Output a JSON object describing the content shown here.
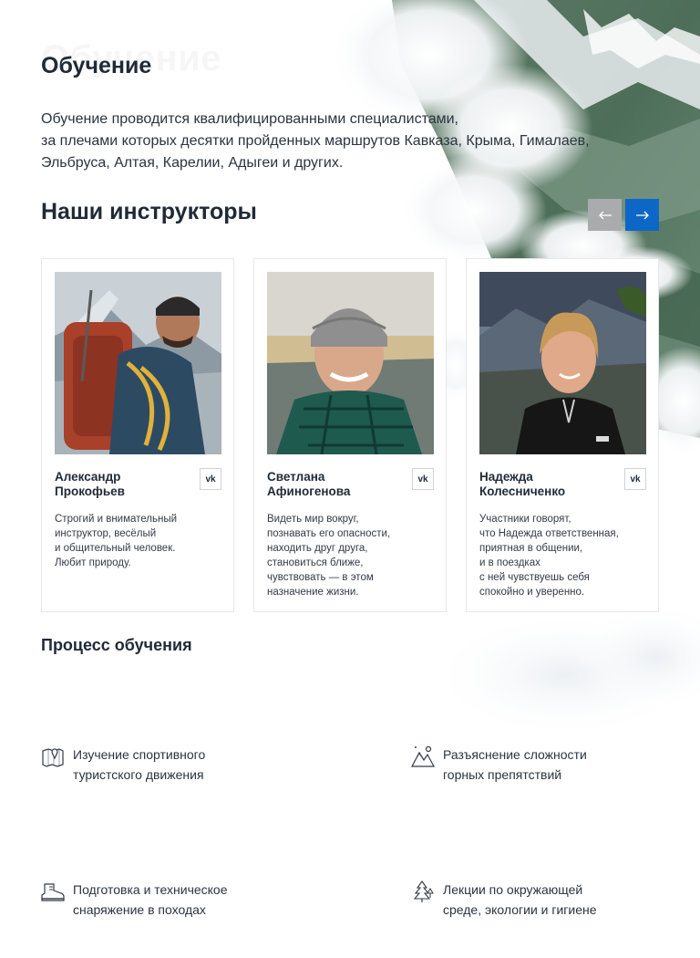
{
  "page": {
    "ghost_title": "Обучение",
    "title": "Обучение",
    "intro_lines": [
      "Обучение проводится квалифицированными специалистами,",
      "за плечами которых десятки пройденных маршрутов Кавказа, Крыма, Гималаев,",
      "Эльбруса, Алтая, Карелии, Адыгеи и других."
    ]
  },
  "instructors": {
    "title": "Наши инструкторы",
    "prev_label": "←",
    "next_label": "→",
    "cards": [
      {
        "name_lines": [
          "Александр",
          "Прокофьев"
        ],
        "vk_label": "vk",
        "desc_lines": [
          "Строгий и внимательный",
          "инструктор, весёлый",
          "и общительный человек.",
          "Любит природу."
        ]
      },
      {
        "name_lines": [
          "Светлана",
          "Афиногенова"
        ],
        "vk_label": "vk",
        "desc_lines": [
          "Видеть мир вокруг,",
          "познавать его опасности,",
          "находить друг друга,",
          "становиться ближе,",
          "чувствовать — в этом",
          "назначение жизни."
        ]
      },
      {
        "name_lines": [
          "Надежда",
          "Колесниченко"
        ],
        "vk_label": "vk",
        "desc_lines": [
          "Участники говорят,",
          "что Надежда ответственная,",
          "приятная в общении,",
          "и в поездках",
          "с ней чувствуешь себя",
          "спокойно и уверенно."
        ]
      }
    ]
  },
  "process": {
    "title": "Процесс обучения",
    "items": [
      {
        "icon": "map-pin-icon",
        "lines": [
          "Изучение спортивного",
          "туристского движения"
        ]
      },
      {
        "icon": "mountains-icon",
        "lines": [
          "Разъяснение сложности",
          "горных препятствий"
        ]
      },
      {
        "icon": "hiking-boot-icon",
        "lines": [
          "Подготовка и техническое",
          "снаряжение в походах"
        ]
      },
      {
        "icon": "trees-icon",
        "lines": [
          "Лекции по окружающей",
          "среде, экологии и гигиене"
        ]
      }
    ]
  },
  "colors": {
    "accent": "#0d67c7",
    "arrow_inactive": "#a9abad",
    "text": "#1f2a37"
  }
}
